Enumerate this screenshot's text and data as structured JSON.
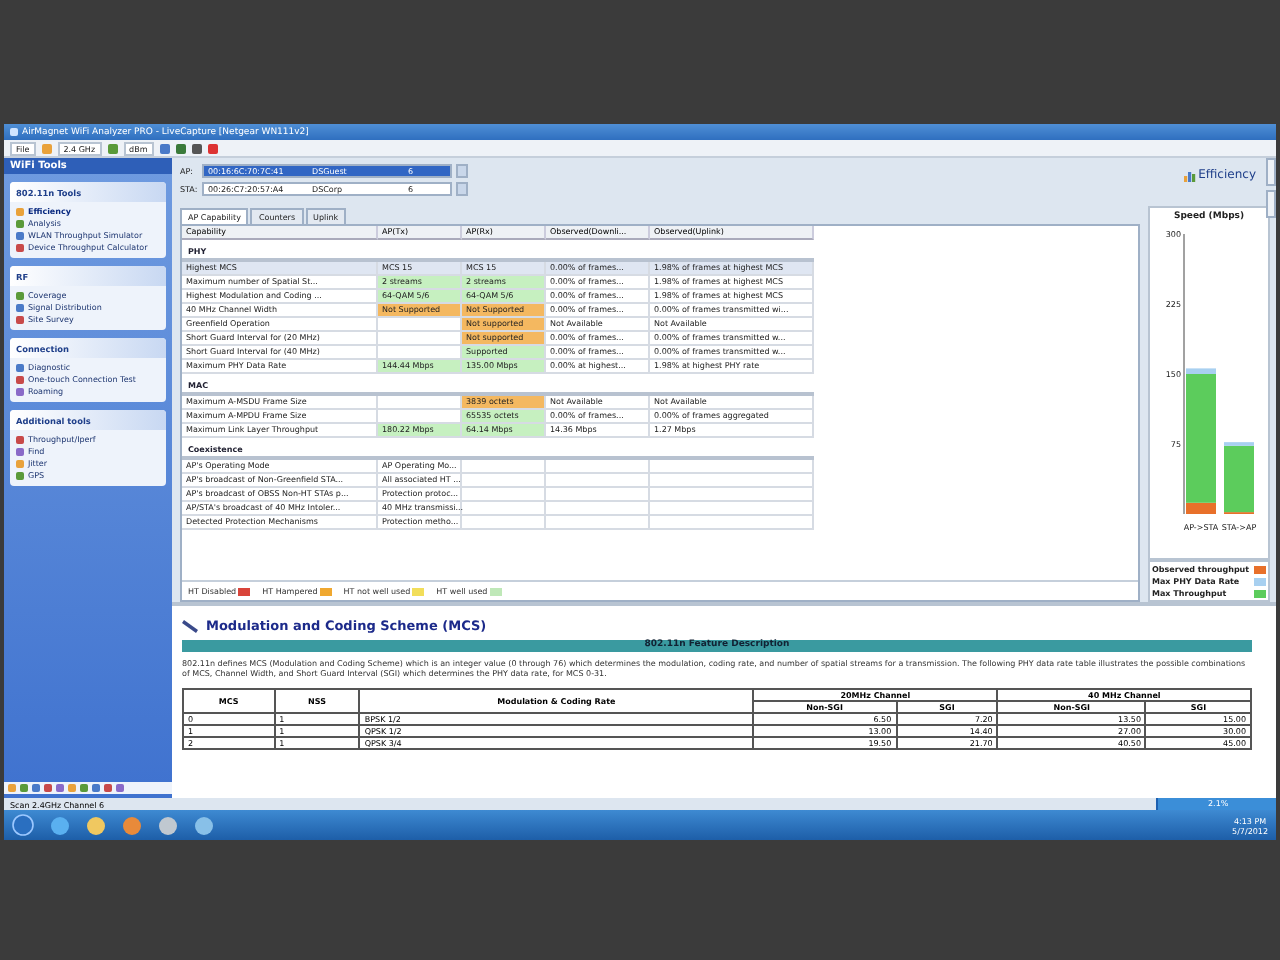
{
  "window": {
    "title": "AirMagnet WiFi Analyzer PRO - LiveCapture [Netgear WN111v2]"
  },
  "toolbar": {
    "items": [
      "File",
      "2.4 GHz",
      "dBm"
    ]
  },
  "sidebar": {
    "title": "WiFi Tools",
    "sections": [
      {
        "title": "802.11n Tools",
        "items": [
          {
            "label": "Efficiency",
            "selected": true
          },
          {
            "label": "Analysis",
            "selected": false
          },
          {
            "label": "WLAN Throughput Simulator",
            "selected": false
          },
          {
            "label": "Device Throughput Calculator",
            "selected": false
          }
        ]
      },
      {
        "title": "RF",
        "items": [
          {
            "label": "Coverage",
            "selected": false
          },
          {
            "label": "Signal Distribution",
            "selected": false
          },
          {
            "label": "Site Survey",
            "selected": false
          }
        ]
      },
      {
        "title": "Connection",
        "items": [
          {
            "label": "Diagnostic",
            "selected": false
          },
          {
            "label": "One-touch Connection Test",
            "selected": false
          },
          {
            "label": "Roaming",
            "selected": false
          }
        ]
      },
      {
        "title": "Additional tools",
        "items": [
          {
            "label": "Throughput/Iperf",
            "selected": false
          },
          {
            "label": "Find",
            "selected": false
          },
          {
            "label": "Jitter",
            "selected": false
          },
          {
            "label": "GPS",
            "selected": false
          }
        ]
      }
    ]
  },
  "selectors": [
    {
      "label": "AP:",
      "mac": "00:16:6C:70:7C:41",
      "ssid": "DSGuest",
      "channel": "6",
      "selected": true
    },
    {
      "label": "STA:",
      "mac": "00:26:C7:20:57:A4",
      "ssid": "DSCorp",
      "channel": "6",
      "selected": false
    }
  ],
  "tabs": [
    {
      "label": "AP Capability",
      "selected": true
    },
    {
      "label": "Counters",
      "selected": false
    },
    {
      "label": "Uplink",
      "selected": false
    }
  ],
  "table": {
    "columns": [
      "Capability",
      "AP(Tx)",
      "AP(Rx)",
      "Observed(Downli...",
      "Observed(Uplink)"
    ],
    "groups": [
      {
        "title": "PHY",
        "rows": [
          {
            "selected": true,
            "cells": [
              {
                "text": "Highest MCS"
              },
              {
                "text": "MCS 15"
              },
              {
                "text": "MCS 15"
              },
              {
                "text": "0.00% of frames..."
              },
              {
                "text": "1.98% of frames at highest MCS"
              }
            ]
          },
          {
            "selected": false,
            "cells": [
              {
                "text": "Maximum number of Spatial St..."
              },
              {
                "text": "2 streams",
                "color": "#c6f0c0"
              },
              {
                "text": "2 streams",
                "color": "#c6f0c0"
              },
              {
                "text": "0.00% of frames..."
              },
              {
                "text": "1.98% of frames at highest MCS"
              }
            ]
          },
          {
            "selected": false,
            "cells": [
              {
                "text": "Highest Modulation and Coding ..."
              },
              {
                "text": "64-QAM 5/6",
                "color": "#c6f0c0"
              },
              {
                "text": "64-QAM 5/6",
                "color": "#c6f0c0"
              },
              {
                "text": "0.00% of frames..."
              },
              {
                "text": "1.98% of frames at highest MCS"
              }
            ]
          },
          {
            "selected": false,
            "cells": [
              {
                "text": "40 MHz Channel Width"
              },
              {
                "text": "Not Supported",
                "color": "#f4b860"
              },
              {
                "text": "Not Supported",
                "color": "#f4b860"
              },
              {
                "text": "0.00% of frames..."
              },
              {
                "text": "0.00% of frames transmitted wi..."
              }
            ]
          },
          {
            "selected": false,
            "cells": [
              {
                "text": "Greenfield Operation"
              },
              {},
              {
                "text": "Not supported",
                "color": "#f4b860"
              },
              {
                "text": "Not Available"
              },
              {
                "text": "Not Available"
              }
            ]
          },
          {
            "selected": false,
            "cells": [
              {
                "text": "Short Guard Interval for (20 MHz)"
              },
              {},
              {
                "text": "Not supported",
                "color": "#f4b860"
              },
              {
                "text": "0.00% of frames..."
              },
              {
                "text": "0.00% of frames transmitted w..."
              }
            ]
          },
          {
            "selected": false,
            "cells": [
              {
                "text": "Short Guard Interval for (40 MHz)"
              },
              {},
              {
                "text": "Supported",
                "color": "#c6f0c0"
              },
              {
                "text": "0.00% of frames..."
              },
              {
                "text": "0.00% of frames transmitted w..."
              }
            ]
          },
          {
            "selected": false,
            "cells": [
              {
                "text": "Maximum PHY Data Rate"
              },
              {
                "text": "144.44 Mbps",
                "color": "#c6f0c0"
              },
              {
                "text": "135.00 Mbps",
                "color": "#c6f0c0"
              },
              {
                "text": "0.00% at highest..."
              },
              {
                "text": "1.98% at highest PHY rate"
              }
            ]
          }
        ]
      },
      {
        "title": "MAC",
        "rows": [
          {
            "selected": false,
            "cells": [
              {
                "text": "Maximum A-MSDU Frame Size"
              },
              {},
              {
                "text": "3839 octets",
                "color": "#f4b860"
              },
              {
                "text": "Not Available"
              },
              {
                "text": "Not Available"
              }
            ]
          },
          {
            "selected": false,
            "cells": [
              {
                "text": "Maximum A-MPDU Frame Size"
              },
              {},
              {
                "text": "65535 octets",
                "color": "#c6f0c0"
              },
              {
                "text": "0.00% of frames..."
              },
              {
                "text": "0.00% of frames aggregated"
              }
            ]
          },
          {
            "selected": false,
            "cells": [
              {
                "text": "Maximum Link Layer Throughput"
              },
              {
                "text": "180.22 Mbps",
                "color": "#c6f0c0"
              },
              {
                "text": "64.14 Mbps",
                "color": "#c6f0c0"
              },
              {
                "text": "14.36 Mbps"
              },
              {
                "text": "1.27 Mbps"
              }
            ]
          }
        ]
      },
      {
        "title": "Coexistence",
        "rows": [
          {
            "selected": false,
            "cells": [
              {
                "text": "AP's Operating Mode"
              },
              {
                "text": "AP Operating Mo..."
              }
            ]
          },
          {
            "selected": false,
            "cells": [
              {
                "text": "AP's broadcast of Non-Greenfield STA..."
              },
              {
                "text": "All associated HT ..."
              }
            ]
          },
          {
            "selected": false,
            "cells": [
              {
                "text": "AP's broadcast of OBSS Non-HT STAs p..."
              },
              {
                "text": "Protection protoc..."
              }
            ]
          },
          {
            "selected": false,
            "cells": [
              {
                "text": "AP/STA's broadcast of 40 MHz Intoler..."
              },
              {
                "text": "40 MHz transmissi..."
              }
            ]
          },
          {
            "selected": false,
            "cells": [
              {
                "text": "Detected Protection Mechanisms"
              },
              {
                "text": "Protection metho..."
              }
            ]
          }
        ]
      }
    ]
  },
  "legend": [
    {
      "label": "HT Disabled",
      "color": "#d9443a"
    },
    {
      "label": "HT Hampered",
      "color": "#f0a830"
    },
    {
      "label": "HT not well used",
      "color": "#f2de5a"
    },
    {
      "label": "HT well used",
      "color": "#bfe8b8"
    }
  ],
  "efficiency": {
    "title": "Efficiency",
    "chart_data": {
      "type": "bar",
      "title": "Speed (Mbps)",
      "categories": [
        "AP->STA",
        "STA->AP"
      ],
      "stacked": true,
      "series": [
        {
          "name": "Observed throughput",
          "color": "#e8702a",
          "values": [
            12,
            2
          ]
        },
        {
          "name": "Max Throughput",
          "color": "#5ccc5c",
          "values": [
            138,
            71
          ]
        },
        {
          "name": "Max PHY Data Rate",
          "color": "#a8d0f0",
          "values": [
            6,
            4
          ]
        }
      ],
      "ylim": [
        0,
        300
      ],
      "yticks": [
        75,
        150,
        225,
        300
      ]
    }
  },
  "info": {
    "heading": "Modulation and Coding Scheme (MCS)",
    "banner": "802.11n Feature Description",
    "text": "802.11n defines MCS (Modulation and Coding Scheme) which is an integer value (0 through 76) which determines the modulation, coding rate, and number of spatial streams for a transmission. The following PHY data rate table illustrates the possible combinations of MCS, Channel Width, and Short Guard Interval (SGI) which determines the PHY data rate, for MCS 0-31.",
    "table": {
      "head": [
        "MCS",
        "NSS",
        "Modulation & Coding Rate",
        "20MHz Channel",
        "40 MHz Channel"
      ],
      "subhead": [
        "Non-SGI",
        "SGI",
        "Non-SGI",
        "SGI"
      ],
      "rows": [
        [
          "0",
          "1",
          "BPSK 1/2",
          "6.50",
          "7.20",
          "13.50",
          "15.00"
        ],
        [
          "1",
          "1",
          "QPSK 1/2",
          "13.00",
          "14.40",
          "27.00",
          "30.00"
        ],
        [
          "2",
          "1",
          "QPSK 3/4",
          "19.50",
          "21.70",
          "40.50",
          "45.00"
        ]
      ]
    }
  },
  "status_bar": {
    "text": "Scan 2.4GHz Channel 6",
    "progress": "2.1%",
    "level": 0.021
  },
  "taskbar": {
    "time": "4:13 PM",
    "date": "5/7/2012"
  }
}
